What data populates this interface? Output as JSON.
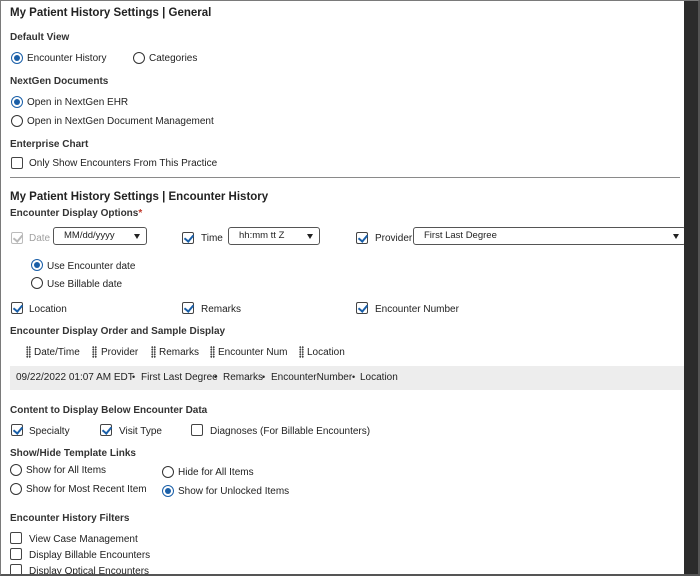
{
  "general": {
    "title": "My Patient History Settings | General",
    "default_view_heading": "Default View",
    "default_view_options": [
      "Encounter History",
      "Categories"
    ],
    "nextgen_docs_heading": "NextGen Documents",
    "nextgen_docs_options": [
      "Open in NextGen EHR",
      "Open in NextGen Document Management"
    ],
    "enterprise_heading": "Enterprise Chart",
    "enterprise_checkbox": "Only Show Encounters From This Practice"
  },
  "encounter_history": {
    "title": "My Patient History Settings | Encounter History",
    "display_options_heading": "Encounter Display Options",
    "required_mark": "*",
    "date_label": "Date",
    "date_format": "MM/dd/yyyy",
    "time_label": "Time",
    "time_format": "hh:mm tt Z",
    "provider_label": "Provider",
    "provider_format": "First Last Degree",
    "date_source_options": [
      "Use Encounter date",
      "Use Billable date"
    ],
    "location_label": "Location",
    "remarks_label": "Remarks",
    "encounter_number_label": "Encounter Number",
    "order_heading": "Encounter Display Order and Sample Display",
    "order_items": [
      "Date/Time",
      "Provider",
      "Remarks",
      "Encounter Num",
      "Location"
    ],
    "sample": {
      "datetime": "09/22/2022 01:07 AM EDT",
      "provider": "First Last Degree",
      "remarks": "Remarks",
      "encounter_number": "EncounterNumber",
      "location": "Location",
      "separator": "•"
    },
    "content_heading": "Content to Display Below Encounter Data",
    "content_options": [
      "Specialty",
      "Visit Type",
      "Diagnoses (For Billable Encounters)"
    ],
    "template_links_heading": "Show/Hide Template Links",
    "template_links_options": [
      "Show for All Items",
      "Show for Most Recent Item",
      "Hide for All Items",
      "Show for Unlocked Items"
    ],
    "filters_heading": "Encounter History Filters",
    "filters": [
      "View Case Management",
      "Display Billable Encounters",
      "Display Optical Encounters"
    ]
  },
  "colors": {
    "accent": "#1a5fa8",
    "sample_bg": "#ededed",
    "required": "#c0392b"
  }
}
